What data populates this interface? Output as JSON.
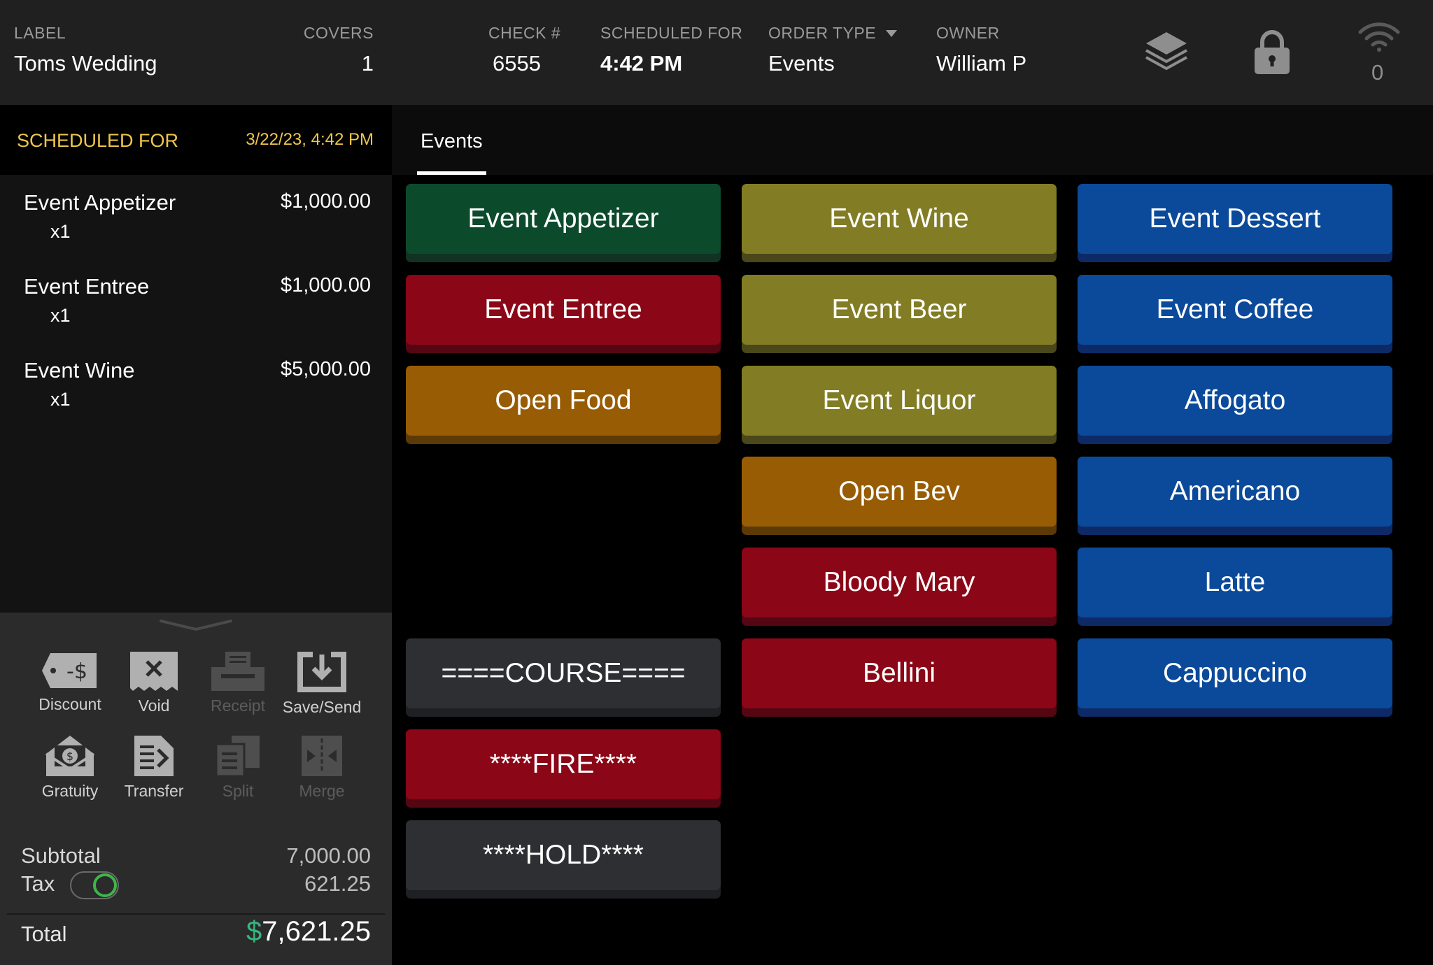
{
  "header": {
    "label_caption": "LABEL",
    "label_value": "Toms Wedding",
    "covers_caption": "COVERS",
    "covers_value": "1",
    "check_caption": "CHECK #",
    "check_value": "6555",
    "scheduled_caption": "SCHEDULED FOR",
    "scheduled_value": "4:42 PM",
    "order_type_caption": "ORDER TYPE",
    "order_type_value": "Events",
    "owner_caption": "OWNER",
    "owner_value": "William P",
    "wifi_count": "0",
    "icons": [
      "layers-icon",
      "lock-icon",
      "wifi-icon"
    ]
  },
  "order": {
    "scheduled_label": "SCHEDULED FOR",
    "scheduled_date": "3/22/23, 4:42 PM",
    "items": [
      {
        "name": "Event Appetizer",
        "qty": "x1",
        "price": "$1,000.00"
      },
      {
        "name": "Event Entree",
        "qty": "x1",
        "price": "$1,000.00"
      },
      {
        "name": "Event Wine",
        "qty": "x1",
        "price": "$5,000.00"
      }
    ]
  },
  "actions": {
    "discount": "Discount",
    "void": "Void",
    "receipt": "Receipt",
    "save_send": "Save/Send",
    "gratuity": "Gratuity",
    "transfer": "Transfer",
    "split": "Split",
    "merge": "Merge"
  },
  "totals": {
    "subtotal_label": "Subtotal",
    "subtotal_value": "7,000.00",
    "tax_label": "Tax",
    "tax_value": "621.25",
    "tax_enabled": true,
    "total_label": "Total",
    "total_currency": "$",
    "total_value": "7,621.25"
  },
  "menu": {
    "tab": "Events",
    "colors": {
      "green": "#0c4a2c",
      "olive": "#827d25",
      "blue": "#0b4a9a",
      "red": "#8b0616",
      "orange": "#985d04",
      "dark": "#2e2f33",
      "accent_yellow": "#f0c64a",
      "accent_green": "#35b77e"
    },
    "buttons": {
      "event_appetizer": "Event Appetizer",
      "event_entree": "Event Entree",
      "open_food": "Open Food",
      "course": "====COURSE====",
      "fire": "****FIRE****",
      "hold": "****HOLD****",
      "event_wine": "Event Wine",
      "event_beer": "Event Beer",
      "event_liquor": "Event Liquor",
      "open_bev": "Open Bev",
      "bloody_mary": "Bloody Mary",
      "bellini": "Bellini",
      "event_dessert": "Event Dessert",
      "event_coffee": "Event Coffee",
      "affogato": "Affogato",
      "americano": "Americano",
      "latte": "Latte",
      "cappuccino": "Cappuccino"
    }
  }
}
